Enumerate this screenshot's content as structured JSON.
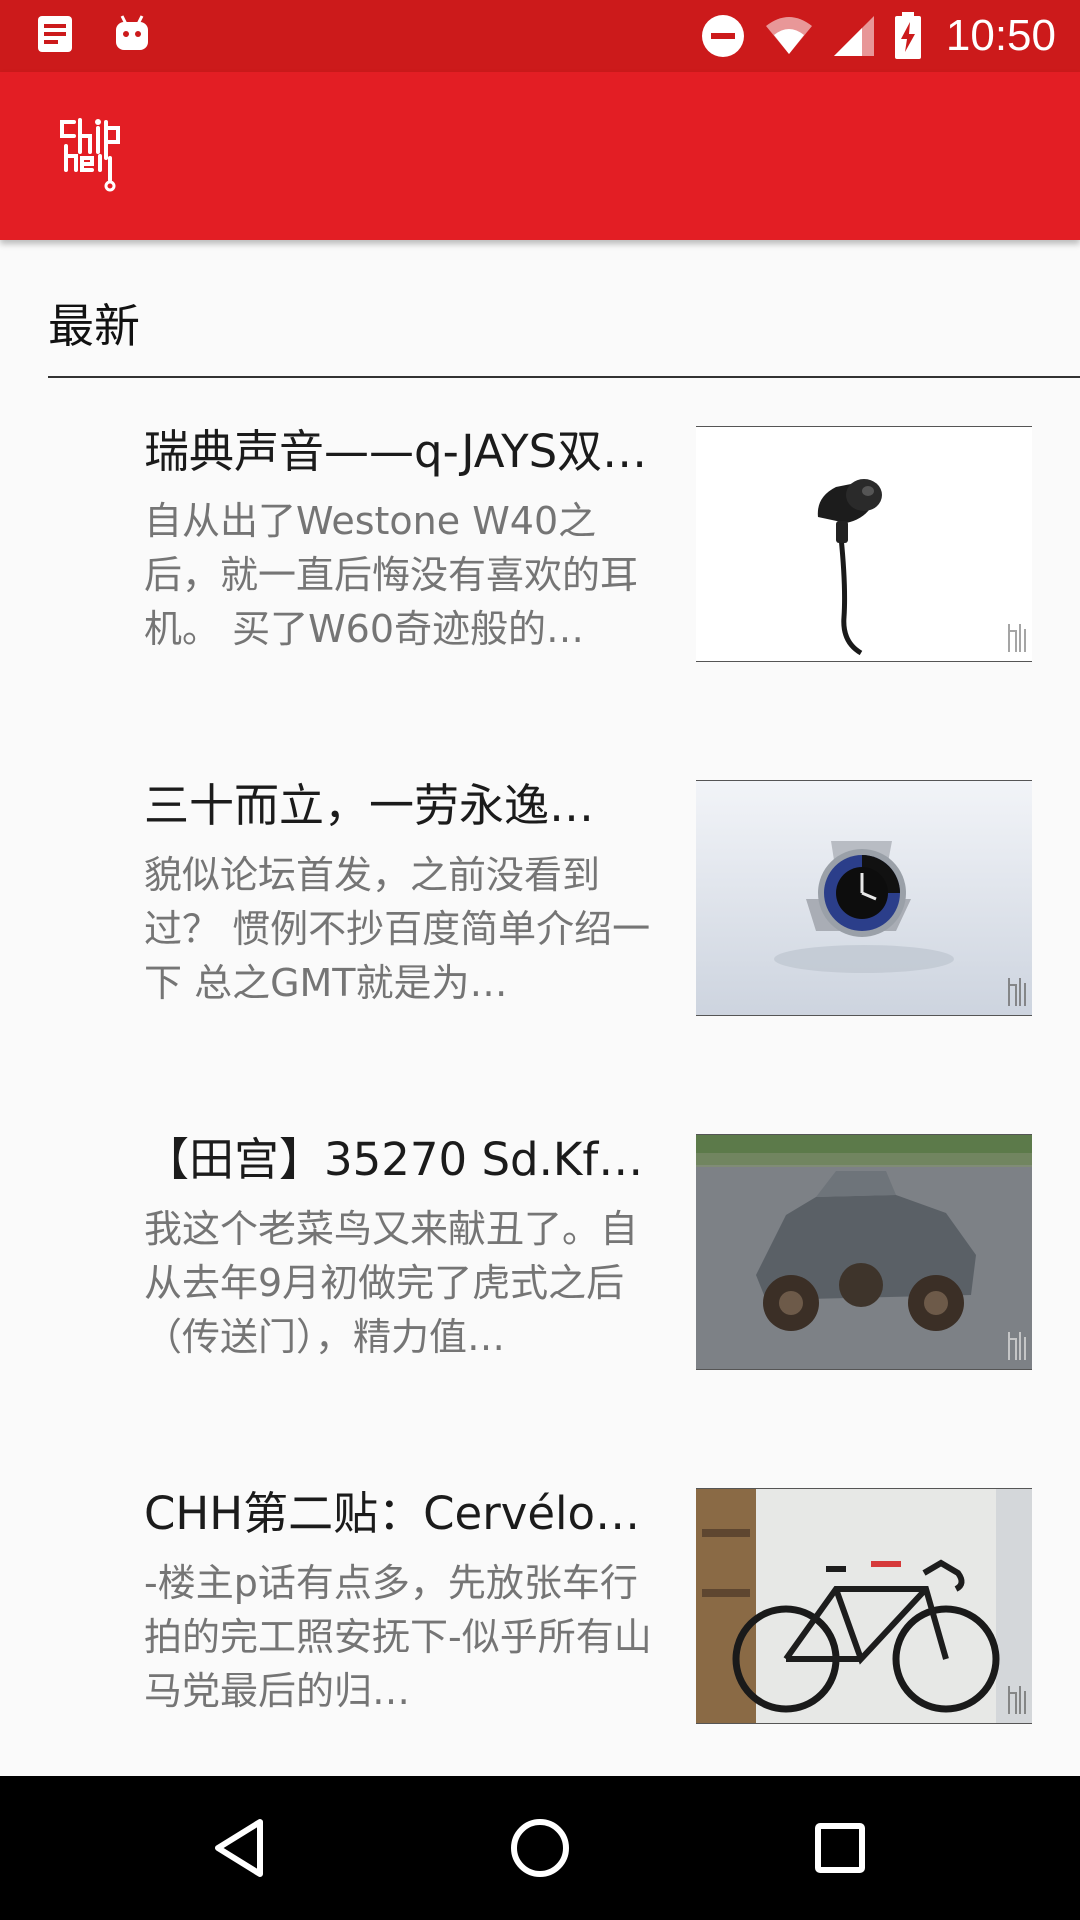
{
  "status_bar": {
    "time": "10:50",
    "icons": [
      "notification-doc-icon",
      "android-icon",
      "do-not-disturb-icon",
      "wifi-icon",
      "signal-icon",
      "battery-charging-icon"
    ],
    "background_color": "#cc1a1b"
  },
  "app_bar": {
    "logo": "chiphell-logo",
    "background_color": "#e31e24"
  },
  "section": {
    "title": "最新"
  },
  "feed": {
    "items": [
      {
        "title": "瑞典声音——q-JAYS双…",
        "excerpt": "自从出了Westone W40之后，就一直后悔没有喜欢的耳机。 买了W60奇迹般的…",
        "thumbnail": "earphone-photo"
      },
      {
        "title": "三十而立，一劳永逸…",
        "excerpt": "貌似论坛首发，之前没看到过？ 惯例不抄百度简单介绍一下 总之GMT就是为…",
        "thumbnail": "watch-photo"
      },
      {
        "title": "【田宫】35270 Sd.Kf…",
        "excerpt": "我这个老菜鸟又来献丑了。自从去年9月初做完了虎式之后（传送门），精力值…",
        "thumbnail": "armored-car-model-photo"
      },
      {
        "title": "CHH第二贴：Cervélo …",
        "excerpt": "-楼主p话有点多，先放张车行拍的完工照安抚下-似乎所有山马党最后的归…",
        "thumbnail": "road-bike-photo"
      }
    ]
  },
  "nav_bar": {
    "buttons": [
      "back-icon",
      "home-icon",
      "recents-icon"
    ]
  }
}
